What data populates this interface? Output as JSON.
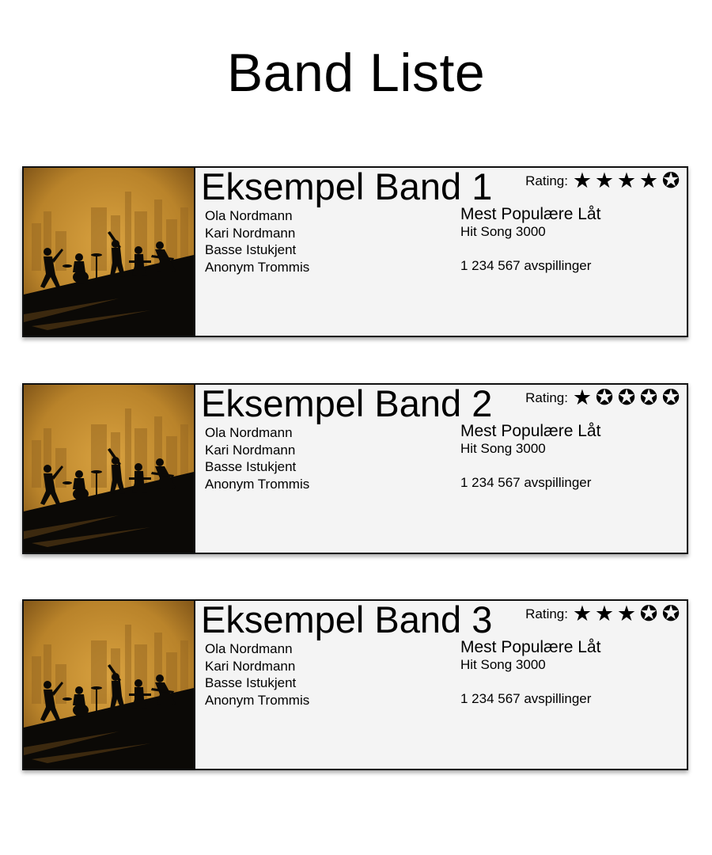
{
  "page": {
    "title": "Band Liste"
  },
  "colors": {
    "card_background": "#f4f4f4",
    "border": "#111111",
    "image_sky_top": "#b9832a",
    "image_sky_glow": "#d9a240",
    "silhouette": "#0b0906"
  },
  "icons": {
    "filled_star": "star-filled-icon",
    "empty_star": "star-outline-icon"
  },
  "bands": [
    {
      "name": "Eksempel Band 1",
      "rating_label": "Rating:",
      "rating": 4,
      "rating_max": 5,
      "members": [
        "Ola Nordmann",
        "Kari Nordmann",
        "Basse Istukjent",
        "Anonym Trommis"
      ],
      "popular_heading": "Mest Populære Låt",
      "popular_song": "Hit Song 3000",
      "plays": "1 234 567 avspillinger"
    },
    {
      "name": "Eksempel Band 2",
      "rating_label": "Rating:",
      "rating": 1,
      "rating_max": 5,
      "members": [
        "Ola Nordmann",
        "Kari Nordmann",
        "Basse Istukjent",
        "Anonym Trommis"
      ],
      "popular_heading": "Mest Populære Låt",
      "popular_song": "Hit Song 3000",
      "plays": "1 234 567 avspillinger"
    },
    {
      "name": "Eksempel Band 3",
      "rating_label": "Rating:",
      "rating": 3,
      "rating_max": 5,
      "members": [
        "Ola Nordmann",
        "Kari Nordmann",
        "Basse Istukjent",
        "Anonym Trommis"
      ],
      "popular_heading": "Mest Populære Låt",
      "popular_song": "Hit Song 3000",
      "plays": "1 234 567 avspillinger"
    }
  ]
}
